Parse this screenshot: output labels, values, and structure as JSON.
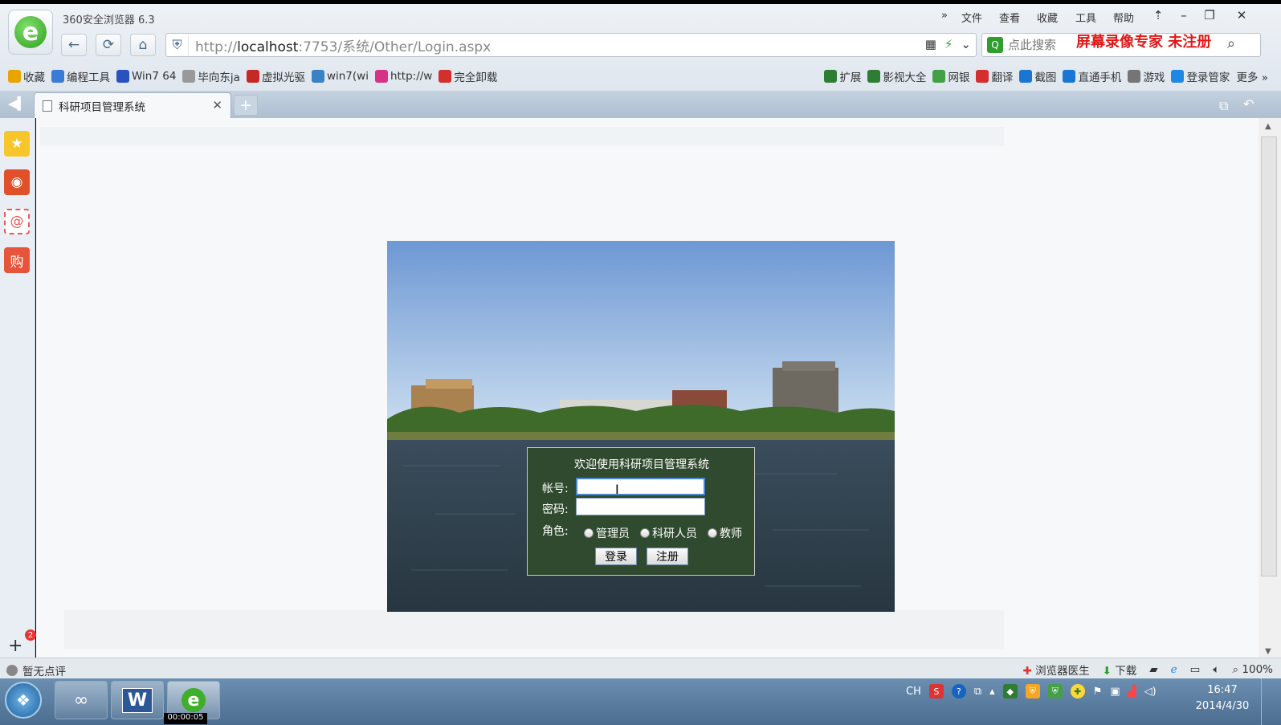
{
  "window": {
    "title": "360安全浏览器 6.3",
    "menu": [
      "»",
      "文件",
      "查看",
      "收藏",
      "工具",
      "帮助"
    ],
    "buttons": [
      "⇡",
      "–",
      "❐",
      "✕"
    ]
  },
  "nav": {
    "back": "←",
    "refresh": "⟳",
    "home": "⌂"
  },
  "address": {
    "value": "http://localhost:7753/系统/Other/Login.aspx",
    "host": "localhost",
    "prefix": "http://",
    "rest": ":7753/系统/Other/Login.aspx"
  },
  "search": {
    "placeholder": "点此搜索"
  },
  "watermark": "屏幕录像专家 未注册",
  "favorites": [
    {
      "label": "收藏",
      "icon": "star-icon",
      "color": "#e8a400"
    },
    {
      "label": "编程工具",
      "icon": "folder-icon",
      "color": "#3a7bd5"
    },
    {
      "label": "Win7 64",
      "icon": "paw-icon",
      "color": "#2a52be"
    },
    {
      "label": "毕向东ja",
      "icon": "page-icon",
      "color": "#999999"
    },
    {
      "label": "虚拟光驱",
      "icon": "disk-icon",
      "color": "#c62828"
    },
    {
      "label": "win7(wi",
      "icon": "globe-icon",
      "color": "#3b82c4"
    },
    {
      "label": "http://w",
      "icon": "pink-icon",
      "color": "#d63384"
    },
    {
      "label": "完全卸载",
      "icon": "uninstall-icon",
      "color": "#d32f2f"
    }
  ],
  "favorites_right": [
    {
      "label": "扩展",
      "icon": "grid-icon",
      "color": "#2e7d32"
    },
    {
      "label": "影视大全",
      "icon": "play-icon",
      "color": "#2e7d32"
    },
    {
      "label": "网银",
      "icon": "shield-icon",
      "color": "#43a047"
    },
    {
      "label": "翻译",
      "icon": "translate-icon",
      "color": "#d32f2f"
    },
    {
      "label": "截图",
      "icon": "scissors-icon",
      "color": "#1976d2"
    },
    {
      "label": "直通手机",
      "icon": "phone-icon",
      "color": "#1976d2"
    },
    {
      "label": "游戏",
      "icon": "gamepad-icon",
      "color": "#757575"
    },
    {
      "label": "登录管家",
      "icon": "key-icon",
      "color": "#1e88e5"
    },
    {
      "label": "更多 »",
      "icon": "",
      "color": ""
    }
  ],
  "tab": {
    "label": "科研项目管理系统",
    "close": "✕",
    "new": "+"
  },
  "login": {
    "title": "欢迎使用科研项目管理系统",
    "account_label": "帐号:",
    "password_label": "密码:",
    "role_label": "角色:",
    "roles": [
      "管理员",
      "科研人员",
      "教师"
    ],
    "login_button": "登录",
    "register_button": "注册"
  },
  "status": {
    "left": "暂无点评",
    "doctor": "浏览器医生",
    "download": "下载",
    "zoom": "100%"
  },
  "taskbar": {
    "timer": "00:00:05",
    "lang": "CH",
    "time": "16:47",
    "date": "2014/4/30"
  },
  "colors": {
    "login_bg": "#2f4a2e",
    "watermark": "#e01818",
    "tabbar": "#b6c6d6"
  }
}
